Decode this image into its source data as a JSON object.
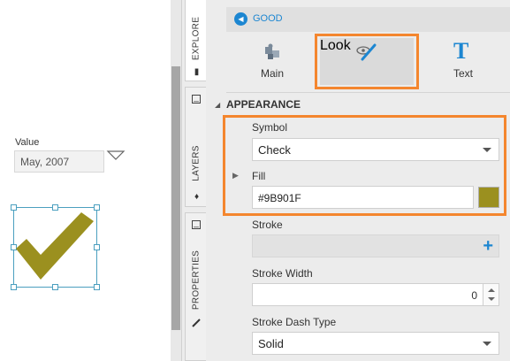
{
  "canvas": {
    "value_label": "Value",
    "value_text": "May, 2007",
    "symbol_color": "#9B901F",
    "selection_color": "#4b9fbf"
  },
  "vertical_tabs": [
    {
      "label": "EXPLORE",
      "icon": "bars-icon",
      "active": true
    },
    {
      "label": "LAYERS",
      "icon": "layers-icon",
      "active": false
    },
    {
      "label": "PROPERTIES",
      "icon": "brush-icon",
      "active": false
    }
  ],
  "panel": {
    "back_title": "GOOD",
    "modes": [
      {
        "label": "Main",
        "icon": "puzzle-icon"
      },
      {
        "label": "Look",
        "icon": "eye-brush-icon",
        "selected": true
      },
      {
        "label": "Text",
        "icon": "text-icon"
      }
    ],
    "section_title": "APPEARANCE",
    "symbol": {
      "label": "Symbol",
      "value": "Check"
    },
    "fill": {
      "label": "Fill",
      "value": "#9B901F",
      "swatch_color": "#9B901F"
    },
    "stroke": {
      "label": "Stroke",
      "add_icon": "plus-icon"
    },
    "stroke_width": {
      "label": "Stroke Width",
      "value": "0"
    },
    "stroke_dash": {
      "label": "Stroke Dash Type",
      "value": "Solid"
    }
  },
  "colors": {
    "accent": "#1c86d1",
    "highlight": "#f4862e"
  }
}
